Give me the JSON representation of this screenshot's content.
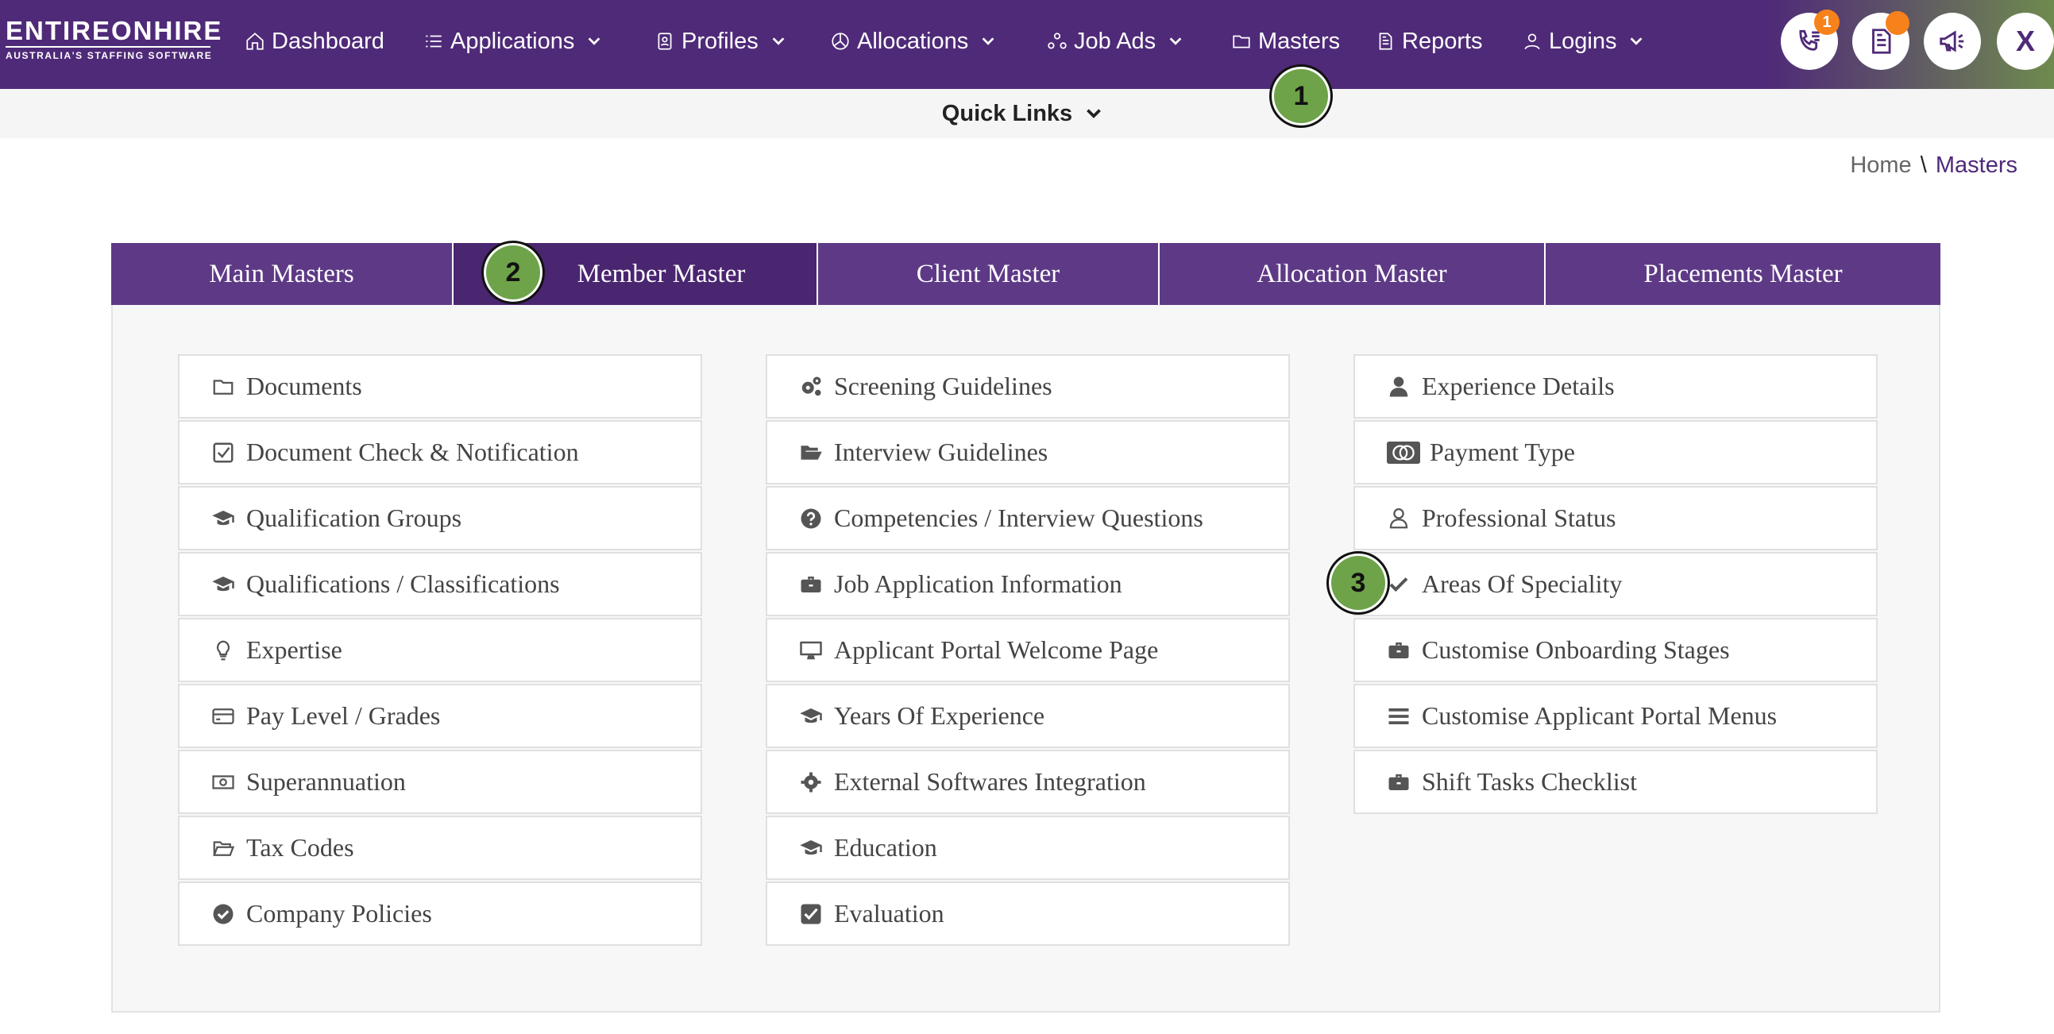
{
  "brand": {
    "logo_main": "ENTIREONHIRE",
    "logo_sub": "AUSTRALIA'S STAFFING SOFTWARE"
  },
  "nav": {
    "items": [
      {
        "label": "Dashboard",
        "icon": "home-icon",
        "dropdown": false
      },
      {
        "label": "Applications",
        "icon": "list-icon",
        "dropdown": true
      },
      {
        "label": "Profiles",
        "icon": "id-badge-icon",
        "dropdown": true
      },
      {
        "label": "Allocations",
        "icon": "pie-chart-icon",
        "dropdown": true
      },
      {
        "label": "Job Ads",
        "icon": "network-icon",
        "dropdown": true
      },
      {
        "label": "Masters",
        "icon": "folder-icon",
        "dropdown": false
      },
      {
        "label": "Reports",
        "icon": "document-icon",
        "dropdown": false
      },
      {
        "label": "Logins",
        "icon": "user-icon",
        "dropdown": true
      }
    ],
    "phone_badge": "1",
    "close_label": "X"
  },
  "quick_links": {
    "label": "Quick Links"
  },
  "breadcrumb": {
    "home": "Home",
    "separator": "\\",
    "current": "Masters"
  },
  "tabs": [
    {
      "label": "Main Masters",
      "active": false
    },
    {
      "label": "Member Master",
      "active": true
    },
    {
      "label": "Client Master",
      "active": false
    },
    {
      "label": "Allocation Master",
      "active": false
    },
    {
      "label": "Placements Master",
      "active": false
    }
  ],
  "columns": [
    {
      "items": [
        {
          "label": "Documents",
          "icon": "folder-icon"
        },
        {
          "label": "Document Check & Notification",
          "icon": "checkbox-icon"
        },
        {
          "label": "Qualification Groups",
          "icon": "graduation-cap-icon"
        },
        {
          "label": "Qualifications / Classifications",
          "icon": "graduation-cap-icon"
        },
        {
          "label": "Expertise",
          "icon": "lightbulb-icon"
        },
        {
          "label": "Pay Level / Grades",
          "icon": "credit-card-icon"
        },
        {
          "label": "Superannuation",
          "icon": "money-icon"
        },
        {
          "label": "Tax Codes",
          "icon": "folder-open-icon"
        },
        {
          "label": "Company Policies",
          "icon": "check-circle-icon"
        }
      ]
    },
    {
      "items": [
        {
          "label": "Screening Guidelines",
          "icon": "gears-icon"
        },
        {
          "label": "Interview Guidelines",
          "icon": "folder-open-solid-icon"
        },
        {
          "label": "Competencies / Interview Questions",
          "icon": "question-circle-icon"
        },
        {
          "label": "Job Application Information",
          "icon": "briefcase-icon"
        },
        {
          "label": "Applicant Portal Welcome Page",
          "icon": "desktop-icon"
        },
        {
          "label": "Years Of Experience",
          "icon": "graduation-cap-icon"
        },
        {
          "label": "External Softwares Integration",
          "icon": "gear-icon"
        },
        {
          "label": "Education",
          "icon": "graduation-cap-icon"
        },
        {
          "label": "Evaluation",
          "icon": "check-square-icon"
        }
      ]
    },
    {
      "items": [
        {
          "label": "Experience Details",
          "icon": "user-solid-icon"
        },
        {
          "label": "Payment Type",
          "icon": "cc-mastercard-icon"
        },
        {
          "label": "Professional Status",
          "icon": "user-outline-icon"
        },
        {
          "label": "Areas Of Speciality",
          "icon": "checkmark-icon"
        },
        {
          "label": "Customise Onboarding Stages",
          "icon": "briefcase-icon"
        },
        {
          "label": "Customise Applicant Portal Menus",
          "icon": "bars-icon"
        },
        {
          "label": "Shift Tasks Checklist",
          "icon": "briefcase-icon"
        }
      ]
    }
  ],
  "markers": [
    "1",
    "2",
    "3"
  ],
  "colors": {
    "primary": "#4f2a78",
    "tab_bg": "#5e3a86",
    "tab_active": "#4a2570",
    "badge": "#f7821b",
    "marker": "#6ea34a"
  }
}
